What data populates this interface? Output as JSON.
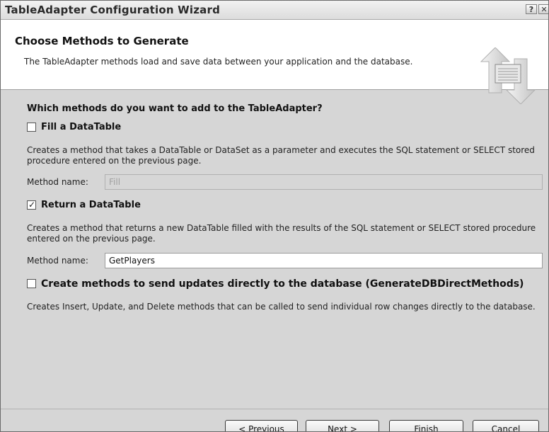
{
  "window": {
    "title": "TableAdapter Configuration Wizard",
    "help_glyph": "?",
    "close_glyph": "✕"
  },
  "header": {
    "title": "Choose Methods to Generate",
    "description": "The TableAdapter methods load and save data between your application and the database."
  },
  "main": {
    "question": "Which methods do you want to add to the TableAdapter?",
    "fill": {
      "label": "Fill a DataTable",
      "checked": false,
      "description": "Creates a method that takes a DataTable or DataSet as a parameter and executes the SQL statement or SELECT stored procedure entered on the previous page.",
      "method_label": "Method name:",
      "method_value": "Fill",
      "enabled": false
    },
    "return": {
      "label": "Return a DataTable",
      "checked": true,
      "check_glyph": "✓",
      "description": "Creates a method that returns a new DataTable filled with the results of the SQL statement or SELECT stored procedure entered on the previous page.",
      "method_label": "Method name:",
      "method_value": "GetPlayers",
      "enabled": true
    },
    "direct": {
      "label": "Create methods to send updates directly to the database (GenerateDBDirectMethods)",
      "checked": false,
      "description": "Creates Insert, Update, and Delete methods that can be called to send individual row changes directly to the database."
    }
  },
  "footer": {
    "previous": "< Previous",
    "next": "Next >",
    "finish": "Finish",
    "cancel": "Cancel"
  }
}
